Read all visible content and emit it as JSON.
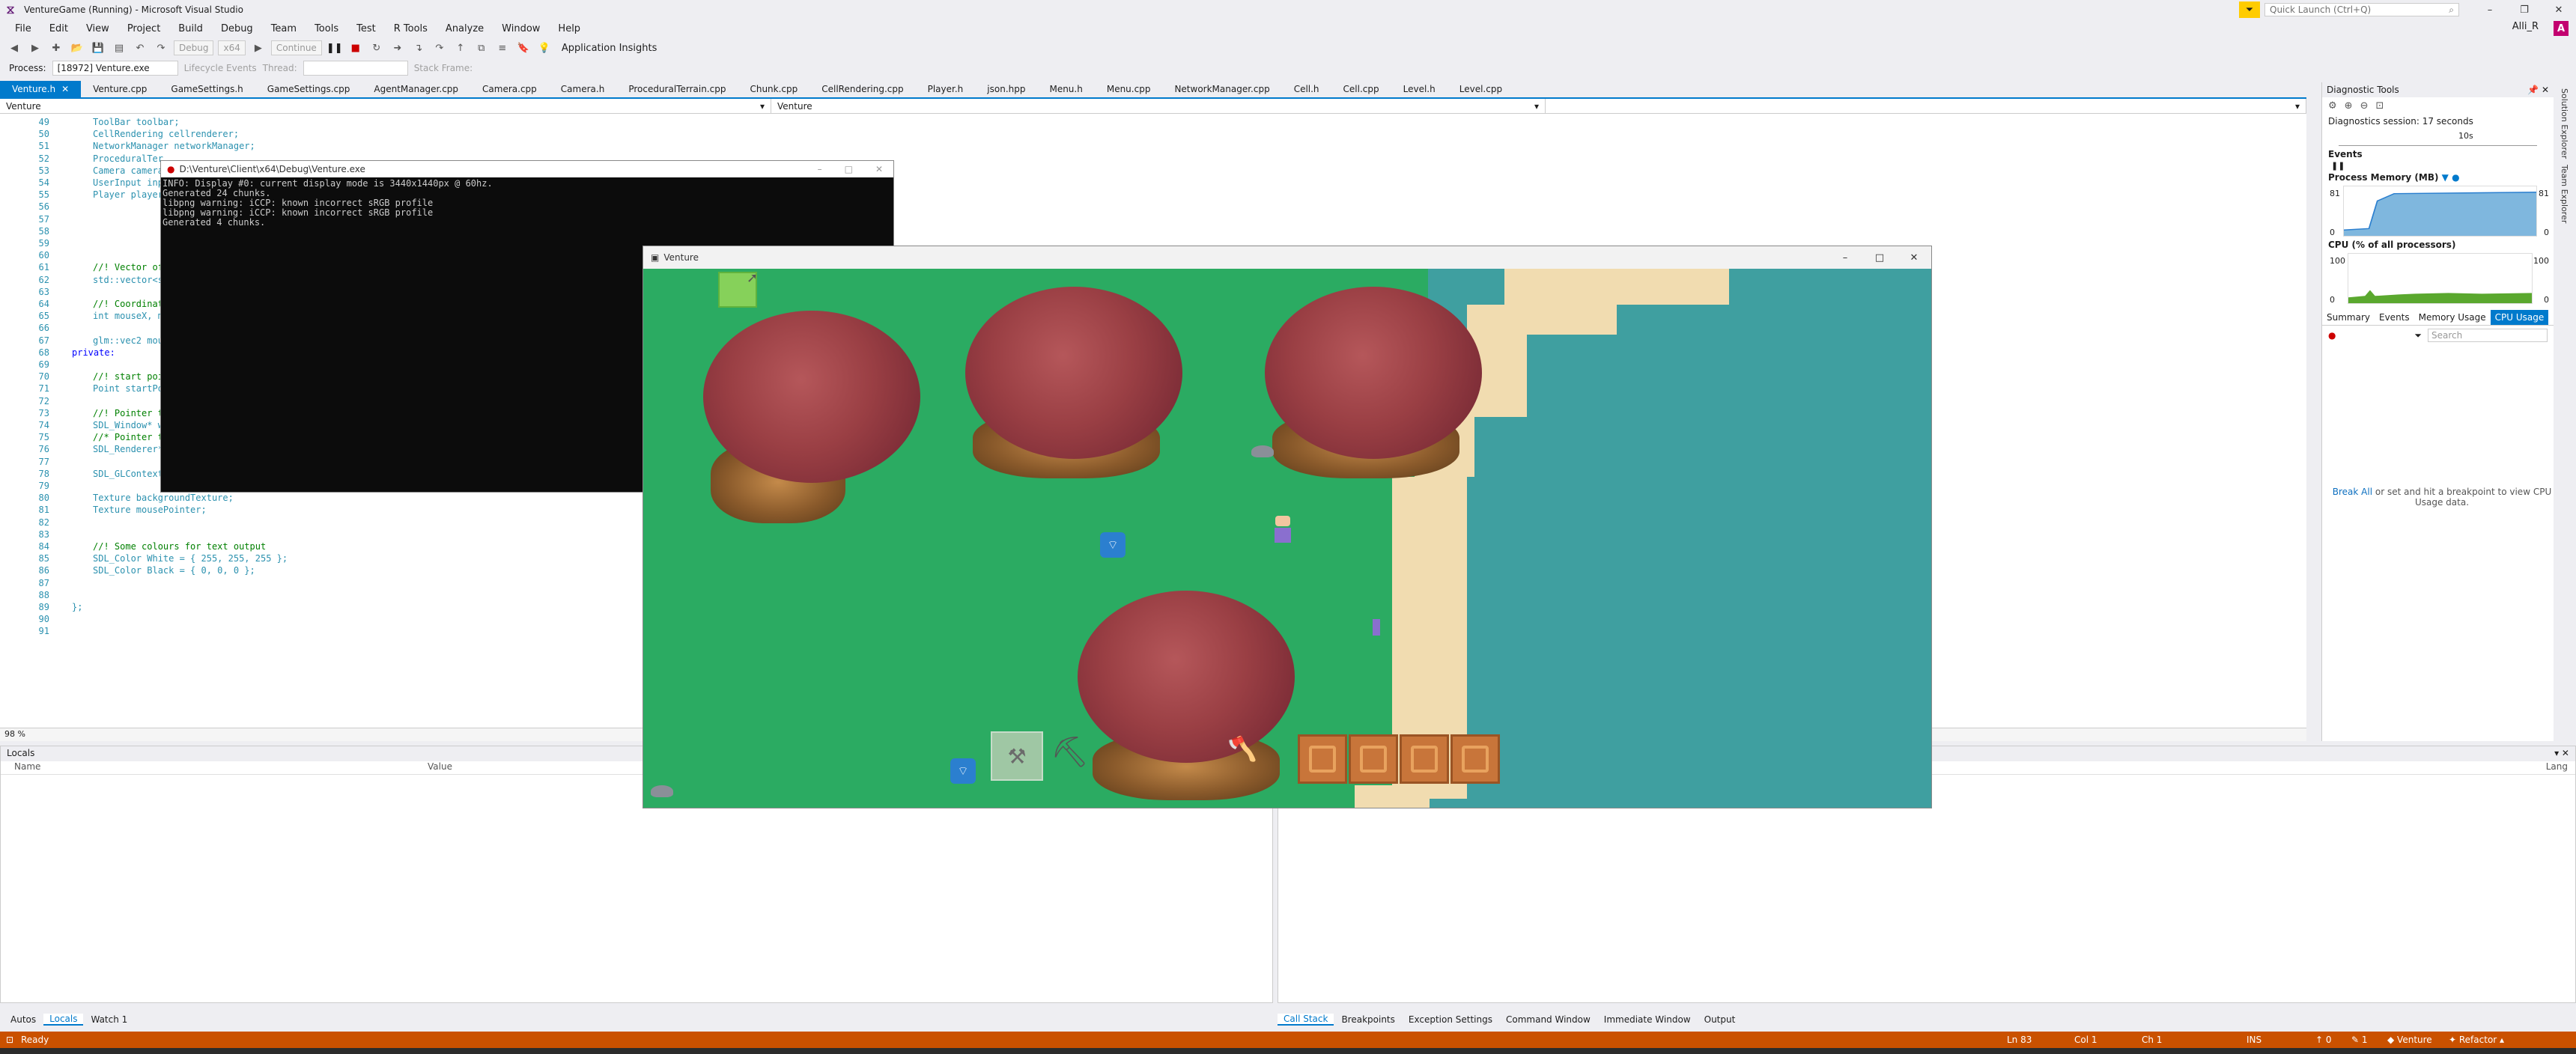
{
  "window": {
    "title": "VentureGame (Running) - Microsoft Visual Studio",
    "account": "Alli_R",
    "avatar": "A",
    "quick_launch": "Quick Launch (Ctrl+Q)"
  },
  "menu": [
    "File",
    "Edit",
    "View",
    "Project",
    "Build",
    "Debug",
    "Team",
    "Tools",
    "Test",
    "R Tools",
    "Analyze",
    "Window",
    "Help"
  ],
  "toolbar": {
    "config": "Debug",
    "platform": "x64",
    "continue": "Continue",
    "app_insights": "Application Insights"
  },
  "toolbar2": {
    "process_label": "Process:",
    "process_value": "[18972] Venture.exe",
    "lifecycle": "Lifecycle Events",
    "thread": "Thread:",
    "stack_frame": "Stack Frame:"
  },
  "tabs": [
    "Venture.h",
    "Venture.cpp",
    "GameSettings.h",
    "GameSettings.cpp",
    "AgentManager.cpp",
    "Camera.cpp",
    "Camera.h",
    "ProceduralTerrain.cpp",
    "Chunk.cpp",
    "CellRendering.cpp",
    "Player.h",
    "json.hpp",
    "Menu.h",
    "Menu.cpp",
    "NetworkManager.cpp",
    "Cell.h",
    "Cell.cpp",
    "Level.h",
    "Level.cpp"
  ],
  "nav": {
    "left": "Venture",
    "middle": "Venture"
  },
  "code": {
    "lines": [
      {
        "n": "49",
        "t": "ToolBar toolbar;"
      },
      {
        "n": "50",
        "t": "CellRendering cellrenderer;"
      },
      {
        "n": "51",
        "t": "NetworkManager networkManager;"
      },
      {
        "n": "52",
        "t": "ProceduralTer"
      },
      {
        "n": "53",
        "t": "Camera camera"
      },
      {
        "n": "54",
        "t": "UserInput inp"
      },
      {
        "n": "55",
        "t": "Player player"
      },
      {
        "n": "56",
        "t": ""
      },
      {
        "n": "57",
        "t": ""
      },
      {
        "n": "58",
        "t": ""
      },
      {
        "n": "59",
        "t": ""
      },
      {
        "n": "60",
        "t": ""
      },
      {
        "n": "61",
        "t": "//! Vector of"
      },
      {
        "n": "62",
        "t": "std::vector<s"
      },
      {
        "n": "63",
        "t": ""
      },
      {
        "n": "64",
        "t": "//! Coordinat"
      },
      {
        "n": "65",
        "t": "int mouseX, m"
      },
      {
        "n": "66",
        "t": ""
      },
      {
        "n": "67",
        "t": "glm::vec2 mou"
      },
      {
        "n": "68",
        "t": "private:"
      },
      {
        "n": "69",
        "t": ""
      },
      {
        "n": "70",
        "t": "//! start poi"
      },
      {
        "n": "71",
        "t": "Point startPo"
      },
      {
        "n": "72",
        "t": ""
      },
      {
        "n": "73",
        "t": "//! Pointer t"
      },
      {
        "n": "74",
        "t": "SDL_Window* w"
      },
      {
        "n": "75",
        "t": "//* Pointer t"
      },
      {
        "n": "76",
        "t": "SDL_Renderer*"
      },
      {
        "n": "77",
        "t": ""
      },
      {
        "n": "78",
        "t": "SDL_GLContext"
      },
      {
        "n": "79",
        "t": ""
      },
      {
        "n": "80",
        "t": "Texture backgroundTexture;"
      },
      {
        "n": "81",
        "t": "Texture mousePointer;"
      },
      {
        "n": "82",
        "t": ""
      },
      {
        "n": "83",
        "t": ""
      },
      {
        "n": "84",
        "t": "//! Some colours for text output"
      },
      {
        "n": "85",
        "t": "SDL_Color White = { 255, 255, 255 };"
      },
      {
        "n": "86",
        "t": "SDL_Color Black = { 0, 0, 0 };"
      },
      {
        "n": "87",
        "t": ""
      },
      {
        "n": "88",
        "t": ""
      },
      {
        "n": "89",
        "t": "};"
      },
      {
        "n": "90",
        "t": ""
      },
      {
        "n": "91",
        "t": ""
      }
    ]
  },
  "zoom": "98 %",
  "console": {
    "title": "D:\\Venture\\Client\\x64\\Debug\\Venture.exe",
    "text": "INFO: Display #0: current display mode is 3440x1440px @ 60hz.\nGenerated 24 chunks.\nlibpng warning: iCCP: known incorrect sRGB profile\nlibpng warning: iCCP: known incorrect sRGB profile\nGenerated 4 chunks."
  },
  "game": {
    "title": "Venture"
  },
  "diag": {
    "title": "Diagnostic Tools",
    "session": "Diagnostics session: 17 seconds",
    "timeline_label": "10s",
    "events": "Events",
    "memory": "Process Memory (MB)",
    "mem_max": "81",
    "mem_min": "0",
    "cpu": "CPU (% of all processors)",
    "cpu_max": "100",
    "cpu_min": "0",
    "tabs": [
      "Summary",
      "Events",
      "Memory Usage",
      "CPU Usage"
    ],
    "search": "Search",
    "break_link": "Break All",
    "break_text": " or set and hit a breakpoint to view CPU Usage data."
  },
  "side_tabs": [
    "Solution Explorer",
    "Team Explorer"
  ],
  "locals": {
    "title": "Locals",
    "col_name": "Name",
    "col_value": "Value"
  },
  "callstack": {
    "col_lang": "Lang"
  },
  "bottom_tabs_left": [
    "Autos",
    "Locals",
    "Watch 1"
  ],
  "bottom_tabs_right": [
    "Call Stack",
    "Breakpoints",
    "Exception Settings",
    "Command Window",
    "Immediate Window",
    "Output"
  ],
  "status": {
    "ready": "Ready",
    "ln": "Ln 83",
    "col": "Col 1",
    "ch": "Ch 1",
    "ins": "INS",
    "up": "0",
    "pencil": "1",
    "project": "Venture",
    "refactor": "Refactor"
  }
}
